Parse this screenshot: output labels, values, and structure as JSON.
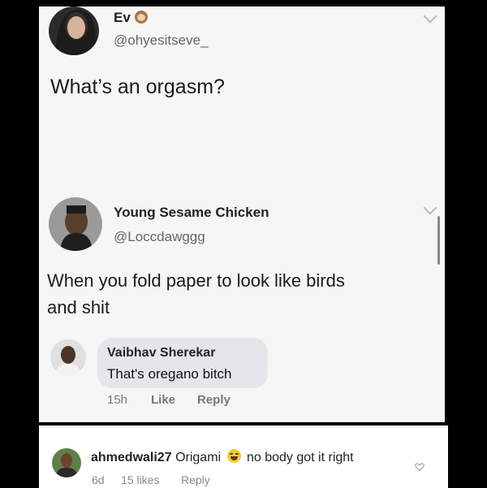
{
  "tweet1": {
    "author_name": "Ev",
    "author_handle": "@ohyesitseve_",
    "text": "What’s an orgasm?"
  },
  "tweet2": {
    "author_name": "Young Sesame Chicken",
    "author_handle": "@Loccdawggg",
    "text_line1": "When you fold paper to look like birds",
    "text_line2": "and shit"
  },
  "fb_comment": {
    "author_name": "Vaibhav Sherekar",
    "text": "That's oregano bitch",
    "time": "15h",
    "like_label": "Like",
    "reply_label": "Reply"
  },
  "ig_comment": {
    "username": "ahmedwali27",
    "text_before_emoji": "Origami",
    "emoji_name": "laughing-emoji",
    "text_after_emoji": "no body got it right",
    "time": "6d",
    "likes": "15 likes",
    "reply_label": "Reply"
  },
  "colors": {
    "background": "#000000",
    "panel": "#f6f6f6",
    "bubble": "#e5e6eb",
    "ig_background": "#ffffff"
  }
}
